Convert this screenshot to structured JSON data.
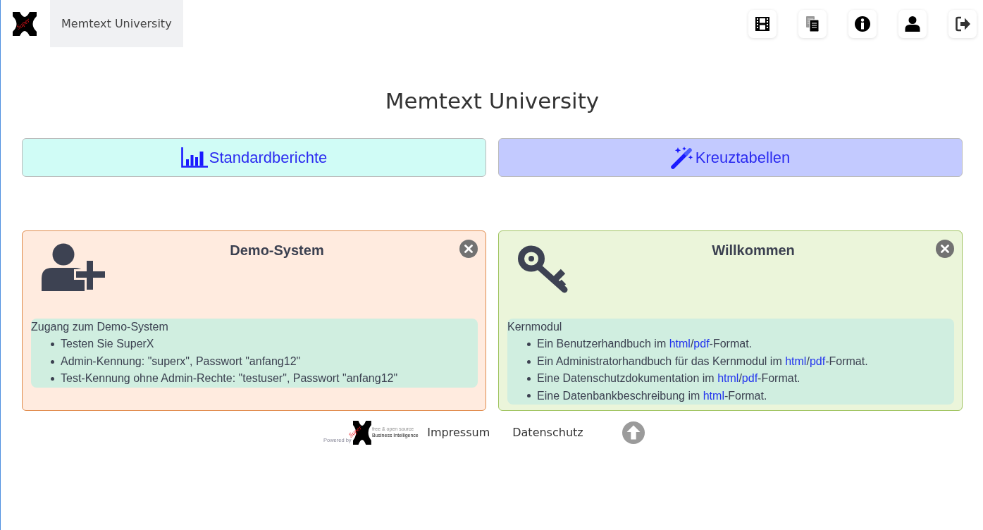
{
  "navbar": {
    "logo_text": "Super",
    "brand": "Memtext University"
  },
  "title": "Memtext University",
  "nav_buttons": [
    {
      "kind": "reports",
      "label": "Standardberichte"
    },
    {
      "kind": "crosstabs",
      "label": "Kreuztabellen"
    }
  ],
  "panels": [
    {
      "kind": "demo",
      "title": "Demo-System",
      "heading": "Zugang zum Demo-System",
      "items": [
        {
          "parts": [
            {
              "text": "Testen Sie SuperX"
            }
          ]
        },
        {
          "parts": [
            {
              "text": "Admin-Kennung: \"superx\", Passwort \"anfang12\""
            }
          ]
        },
        {
          "parts": [
            {
              "text": "Test-Kennung ohne Admin-Rechte: \"testuser\", Passwort \"anfang12\""
            }
          ]
        }
      ]
    },
    {
      "kind": "welcome",
      "title": "Willkommen",
      "heading": "Kernmodul",
      "items": [
        {
          "parts": [
            {
              "text": "Ein Benutzerhandbuch im "
            },
            {
              "link": "html"
            },
            {
              "text": "/"
            },
            {
              "link": "pdf"
            },
            {
              "text": "-Format."
            }
          ]
        },
        {
          "parts": [
            {
              "text": "Ein Administratorhandbuch für das Kernmodul im "
            },
            {
              "link": "html"
            },
            {
              "text": "/"
            },
            {
              "link": "pdf"
            },
            {
              "text": "-Format."
            }
          ]
        },
        {
          "parts": [
            {
              "text": "Eine Datenschutzdokumentation im "
            },
            {
              "link": "html"
            },
            {
              "text": "/"
            },
            {
              "link": "pdf"
            },
            {
              "text": "-Format."
            }
          ]
        },
        {
          "parts": [
            {
              "text": "Eine Datenbankbeschreibung im "
            },
            {
              "link": "html"
            },
            {
              "text": "-Format."
            }
          ]
        }
      ]
    }
  ],
  "footer": {
    "logo": {
      "powered_by": "Powered by",
      "logo_text": "Super",
      "tagline": "free & open source",
      "product": "Business Intelligence"
    },
    "links": [
      "Impressum",
      "Datenschutz"
    ]
  }
}
